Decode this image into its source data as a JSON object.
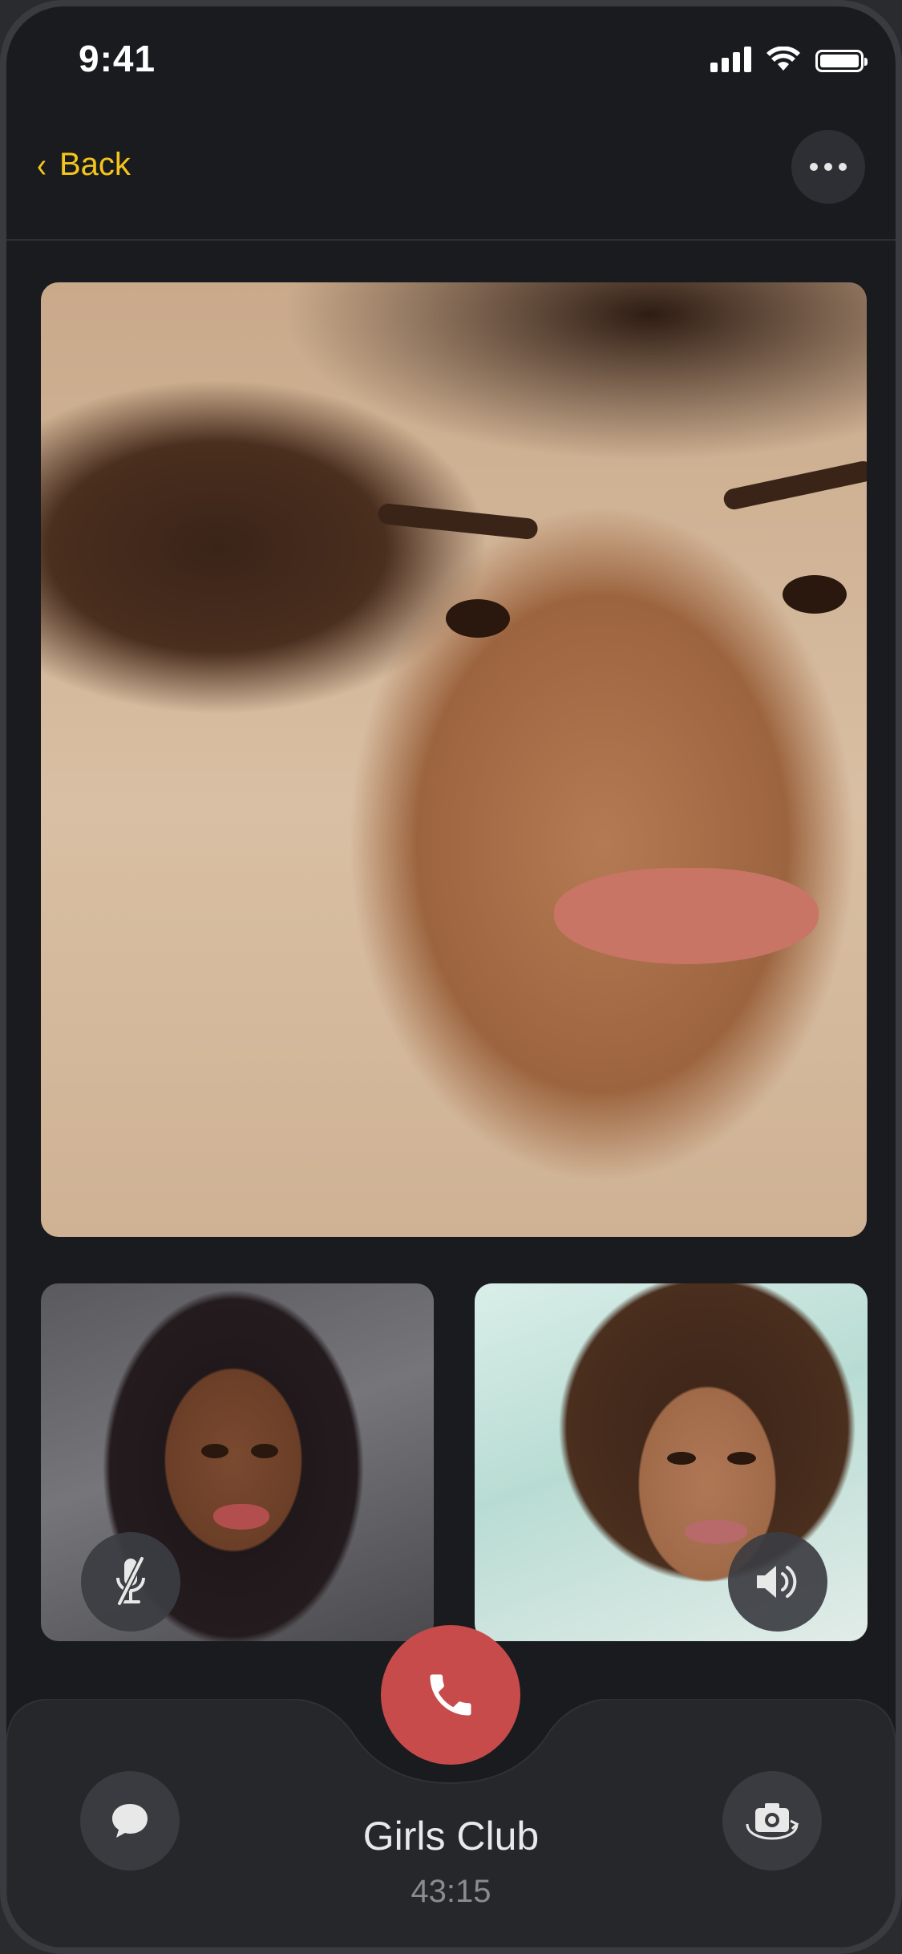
{
  "status_bar": {
    "time": "9:41"
  },
  "nav": {
    "back_label": "Back",
    "back_icon": "chevron-left-icon",
    "more_icon": "ellipsis-icon"
  },
  "participants": {
    "main": {
      "icon": "video-feed"
    },
    "left_tile": {
      "control_icon": "microphone-muted-icon"
    },
    "right_tile": {
      "control_icon": "speaker-icon"
    }
  },
  "call": {
    "title": "Girls Club",
    "duration": "43:15",
    "end_call_icon": "phone-icon",
    "chat_icon": "chat-bubble-icon",
    "flip_camera_icon": "camera-rotate-icon"
  },
  "colors": {
    "accent": "#f5c51b",
    "end_call": "#c84b4b",
    "background": "#1a1b1f",
    "panel": "#26272b"
  }
}
